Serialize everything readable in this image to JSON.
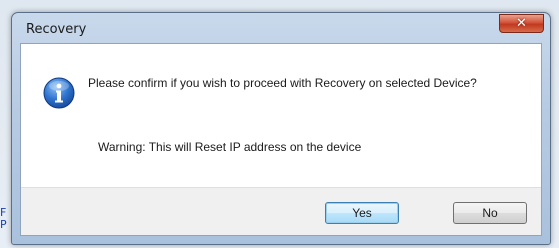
{
  "background": {
    "left_fragment_1": "F",
    "left_fragment_2": "P"
  },
  "dialog": {
    "title": "Recovery",
    "close_label": "✕",
    "message": "Please confirm if you wish to proceed with Recovery on selected Device?",
    "warning": "Warning: This will Reset IP address on the device",
    "icon": "info-icon",
    "buttons": {
      "yes": "Yes",
      "no": "No"
    }
  },
  "colors": {
    "close_button": "#c0391f",
    "info_icon": "#1e5fb5",
    "default_button_border": "#3c7fb1"
  }
}
